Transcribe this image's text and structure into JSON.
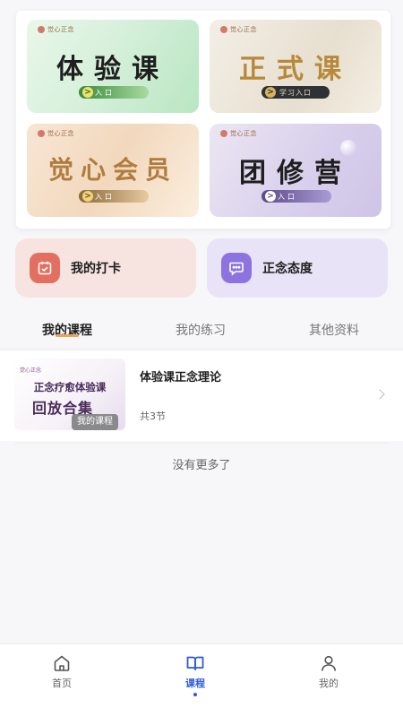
{
  "colors": {
    "accent": "#2e5bd8",
    "tab_indicator": "#e5a85a",
    "checkin_icon_bg": "#e27060",
    "attitude_icon_bg": "#8c73e0"
  },
  "banners": [
    {
      "title": "体验课",
      "entry": "入口",
      "logo": "觉心正念"
    },
    {
      "title": "正式课",
      "entry": "学习入口",
      "logo": "觉心正念"
    },
    {
      "title": "觉心会员",
      "entry": "入口",
      "logo": "觉心正念"
    },
    {
      "title": "团修营",
      "entry": "入口",
      "logo": "觉心正念"
    }
  ],
  "actions": [
    {
      "label": "我的打卡",
      "icon": "calendar-icon"
    },
    {
      "label": "正念态度",
      "icon": "chat-icon"
    }
  ],
  "tabs": [
    {
      "label": "我的课程",
      "active": true
    },
    {
      "label": "我的练习",
      "active": false
    },
    {
      "label": "其他资料",
      "active": false
    }
  ],
  "course": {
    "thumb_logo": "觉心正念",
    "thumb_line1": "正念疗愈体验课",
    "thumb_line2": "回放合集",
    "thumb_badge": "我的课程",
    "title": "体验课正念理论",
    "count": "共3节"
  },
  "list_end": "没有更多了",
  "nav": [
    {
      "label": "首页",
      "icon": "home-icon",
      "active": false
    },
    {
      "label": "课程",
      "icon": "book-icon",
      "active": true
    },
    {
      "label": "我的",
      "icon": "user-icon",
      "active": false
    }
  ]
}
